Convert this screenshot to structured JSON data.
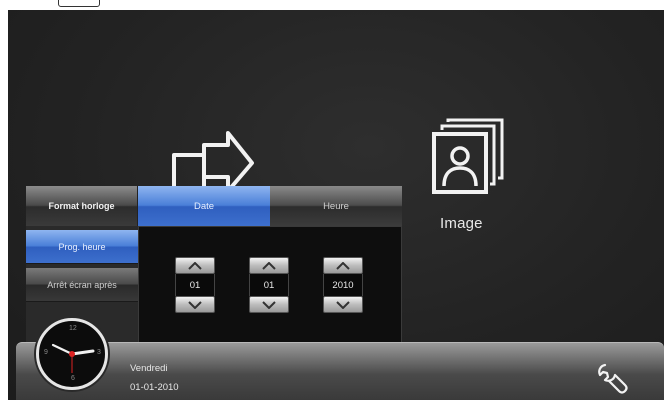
{
  "icons": {
    "home": "home-export-icon",
    "image": "picture-frame-icon",
    "settings": "wrench-icon",
    "clock": "analog-clock-icon"
  },
  "main": {
    "image_label": "Image"
  },
  "dialog": {
    "tabs": [
      {
        "label": "Format horloge",
        "active": false
      },
      {
        "label": "Date",
        "active": true
      },
      {
        "label": "Heure",
        "active": false
      }
    ],
    "side_items": [
      {
        "label": "Prog. heure",
        "active": true
      },
      {
        "label": "Arrêt écran après",
        "active": false
      }
    ],
    "spinners": [
      {
        "value": "01"
      },
      {
        "value": "01"
      },
      {
        "value": "2010"
      }
    ]
  },
  "bottombar": {
    "day": "Vendredi",
    "date": "01-01-2010"
  },
  "clock": {
    "numbers": [
      "12",
      "3",
      "6",
      "9"
    ]
  },
  "colors": {
    "accent_blue": "#4a7fd8",
    "background": "#232323",
    "text": "#e8e8e8"
  }
}
